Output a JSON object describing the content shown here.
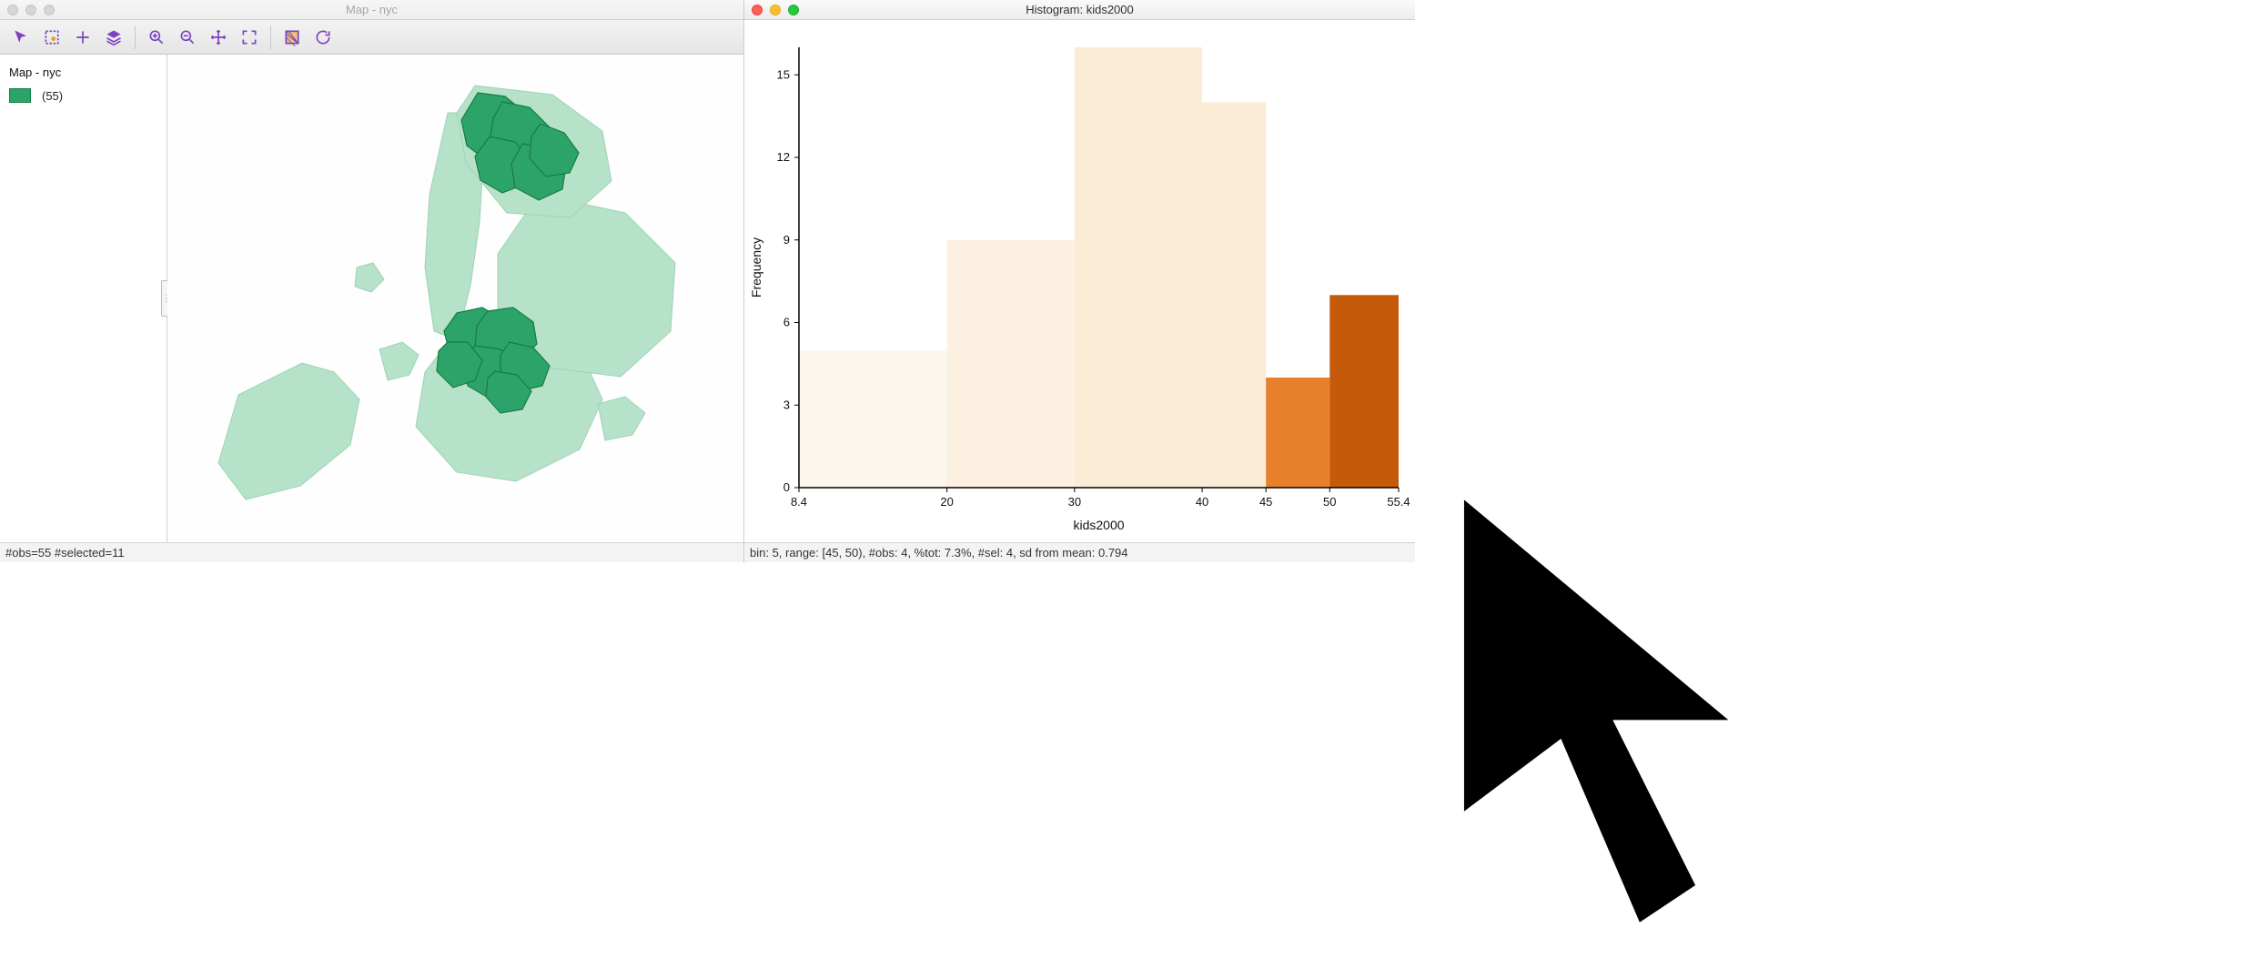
{
  "left_window": {
    "title": "Map - nyc",
    "toolbar": {
      "pointer": "pointer-icon",
      "select_rect": "select-rect-icon",
      "pan": "pan-icon",
      "layers": "layers-icon",
      "zoom_in": "zoom-in-icon",
      "zoom_out": "zoom-out-icon",
      "full_extent": "full-extent-icon",
      "fit": "fit-icon",
      "hatching": "hatching-icon",
      "refresh": "refresh-icon"
    },
    "legend": {
      "title": "Map - nyc",
      "swatch_color": "#2ca469",
      "count_label": "(55)"
    },
    "map_colors": {
      "background_fill": "#b6e2c9",
      "background_stroke": "#9fd2b6",
      "selected_fill": "#2ca469",
      "selected_stroke": "#1a7a43"
    },
    "statusbar": "#obs=55 #selected=11"
  },
  "right_window": {
    "title": "Histogram: kids2000",
    "ylabel": "Frequency",
    "xlabel": "kids2000",
    "statusbar": "bin: 5, range: [45, 50), #obs: 4, %tot: 7.3%, #sel: 4, sd from mean: 0.794"
  },
  "chart_data": {
    "type": "bar",
    "title": "Histogram: kids2000",
    "xlabel": "kids2000",
    "ylabel": "Frequency",
    "y_ticks": [
      0,
      3,
      6,
      9,
      12,
      15
    ],
    "x_ticks": [
      "8.4",
      "20",
      "30",
      "40",
      "45",
      "50",
      "55.4"
    ],
    "ylim": [
      0,
      16
    ],
    "bins": [
      {
        "range": [
          8.4,
          20
        ],
        "value": 5,
        "selected": false,
        "color": "#fdf6ec"
      },
      {
        "range": [
          20,
          30
        ],
        "value": 9,
        "selected": false,
        "color": "#fcf1e1"
      },
      {
        "range": [
          30,
          40
        ],
        "value": 16,
        "selected": false,
        "color": "#fbecd6"
      },
      {
        "range": [
          40,
          45
        ],
        "value": 14,
        "selected": false,
        "color": "#fbecd6"
      },
      {
        "range": [
          45,
          50
        ],
        "value": 4,
        "selected": true,
        "color": "#e8802b"
      },
      {
        "range": [
          50,
          55.4
        ],
        "value": 7,
        "selected": true,
        "color": "#c45a0a"
      }
    ]
  }
}
